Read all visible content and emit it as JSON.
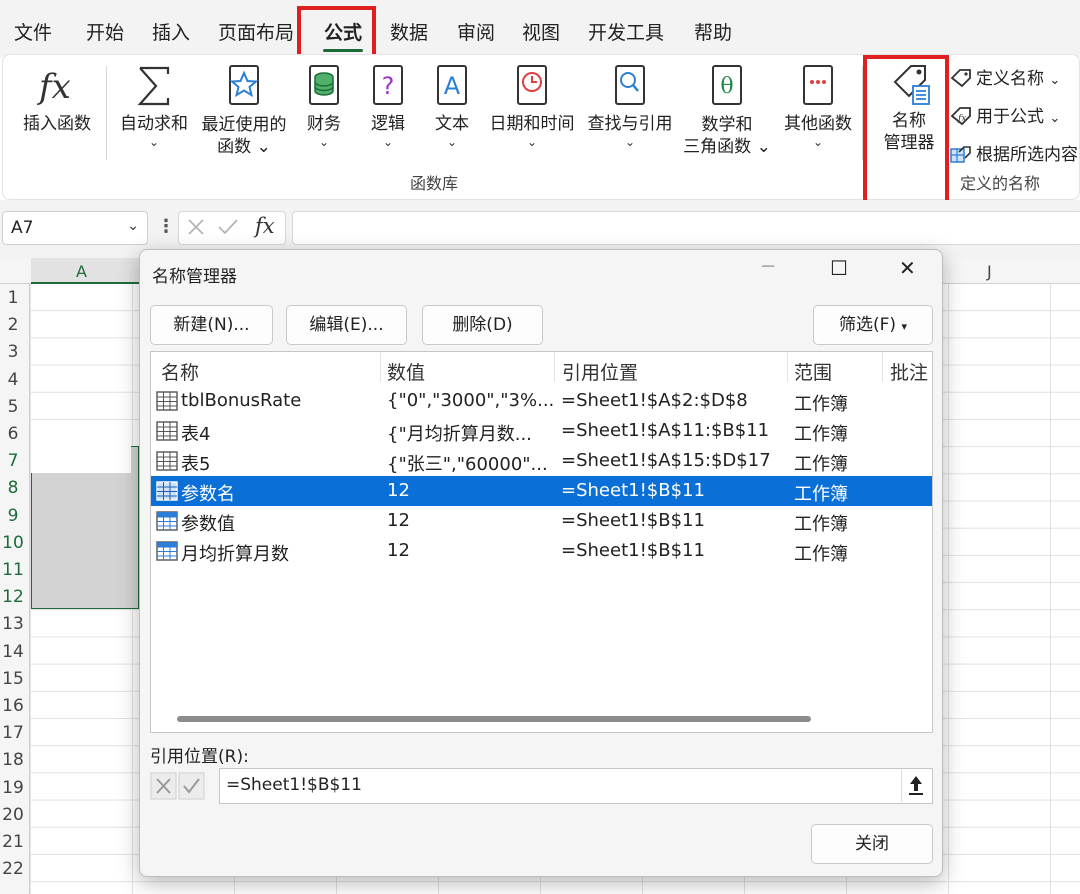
{
  "ribbon_tabs": [
    "文件",
    "开始",
    "插入",
    "页面布局",
    "公式",
    "数据",
    "审阅",
    "视图",
    "开发工具",
    "帮助"
  ],
  "active_tab": "公式",
  "function_library": {
    "insert_function": "插入函数",
    "autosum": "自动求和",
    "recent": [
      "最近使用的",
      "函数"
    ],
    "financial": "财务",
    "logical": "逻辑",
    "text": "文本",
    "datetime": "日期和时间",
    "lookup": "查找与引用",
    "math": [
      "数学和",
      "三角函数"
    ],
    "more": "其他函数",
    "group_label": "函数库"
  },
  "defined_names": {
    "name_manager": [
      "名称",
      "管理器"
    ],
    "define_name": "定义名称",
    "use_in_formula": "用于公式",
    "create_from_selection": "根据所选内容",
    "group_label": "定义的名称"
  },
  "formula_bar": {
    "cell_ref": "A7",
    "fx": "fx"
  },
  "sheet": {
    "columns": [
      "A",
      "J"
    ],
    "rows": [
      "1",
      "2",
      "3",
      "4",
      "5",
      "6",
      "7",
      "8",
      "9",
      "10",
      "11",
      "12",
      "13",
      "14",
      "15",
      "16",
      "17",
      "18",
      "19",
      "20",
      "21",
      "22"
    ]
  },
  "dialog": {
    "title": "名称管理器",
    "buttons": {
      "new": "新建(N)...",
      "edit": "编辑(E)...",
      "delete": "删除(D)",
      "filter": "筛选(F)"
    },
    "columns": [
      "名称",
      "数值",
      "引用位置",
      "范围",
      "批注"
    ],
    "rows": [
      {
        "name": "tblBonusRate",
        "value": "{\"0\",\"3000\",\"3%...",
        "refers_to": "=Sheet1!$A$2:$D$8",
        "scope": "工作簿"
      },
      {
        "name": "表4",
        "value": "{\"月均折算月数...",
        "refers_to": "=Sheet1!$A$11:$B$11",
        "scope": "工作簿"
      },
      {
        "name": "表5",
        "value": "{\"张三\",\"60000\"...",
        "refers_to": "=Sheet1!$A$15:$D$17",
        "scope": "工作簿"
      },
      {
        "name": "参数名",
        "value": "12",
        "refers_to": "=Sheet1!$B$11",
        "scope": "工作簿"
      },
      {
        "name": "参数值",
        "value": "12",
        "refers_to": "=Sheet1!$B$11",
        "scope": "工作簿"
      },
      {
        "name": "月均折算月数",
        "value": "12",
        "refers_to": "=Sheet1!$B$11",
        "scope": "工作簿"
      }
    ],
    "selected_row": "参数名",
    "refers_to_label": "引用位置(R):",
    "refers_to_value": "=Sheet1!$B$11",
    "close": "关闭"
  },
  "colors": {
    "highlight_red": "#e02020",
    "selection_blue": "#0a6fd6",
    "excel_green": "#1e6b3a"
  }
}
